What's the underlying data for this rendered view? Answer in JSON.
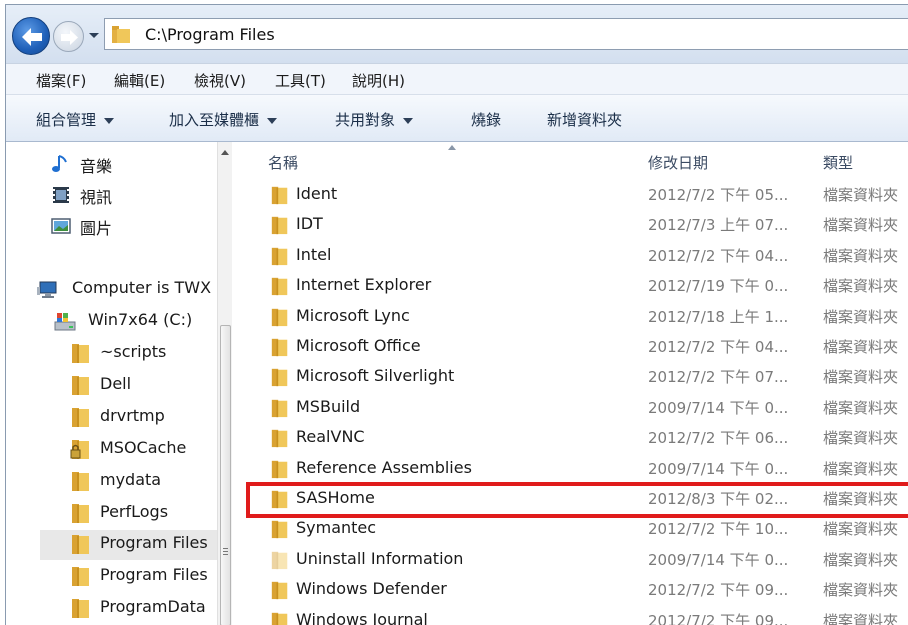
{
  "address": {
    "path": "C:\\Program Files"
  },
  "menu": [
    "檔案(F)",
    "編輯(E)",
    "檢視(V)",
    "工具(T)",
    "說明(H)"
  ],
  "commands": [
    {
      "label": "組合管理",
      "dropdown": true
    },
    {
      "label": "加入至媒體櫃",
      "dropdown": true
    },
    {
      "label": "共用對象",
      "dropdown": true
    },
    {
      "label": "燒錄",
      "dropdown": false
    },
    {
      "label": "新增資料夾",
      "dropdown": false
    }
  ],
  "nav": {
    "libraries": [
      {
        "label": "音樂",
        "icon": "music-icon"
      },
      {
        "label": "視訊",
        "icon": "video-icon"
      },
      {
        "label": "圖片",
        "icon": "picture-icon"
      }
    ],
    "computer": {
      "label": "Computer is TWX",
      "icon": "computer-icon"
    },
    "drive": {
      "label": "Win7x64 (C:)",
      "icon": "drive-icon"
    },
    "folders": [
      {
        "label": "~scripts"
      },
      {
        "label": "Dell"
      },
      {
        "label": "drvrtmp"
      },
      {
        "label": "MSOCache",
        "locked": true
      },
      {
        "label": "mydata"
      },
      {
        "label": "PerfLogs"
      },
      {
        "label": "Program Files",
        "selected": true
      },
      {
        "label": "Program Files"
      },
      {
        "label": "ProgramData"
      }
    ]
  },
  "columns": {
    "name": "名稱",
    "date": "修改日期",
    "type": "類型"
  },
  "files": [
    {
      "name": "Ident",
      "date": "2012/7/2 下午 05...",
      "type": "檔案資料夾"
    },
    {
      "name": "IDT",
      "date": "2012/7/3 上午 07...",
      "type": "檔案資料夾"
    },
    {
      "name": "Intel",
      "date": "2012/7/2 下午 04...",
      "type": "檔案資料夾"
    },
    {
      "name": "Internet Explorer",
      "date": "2012/7/19 下午 0...",
      "type": "檔案資料夾"
    },
    {
      "name": "Microsoft Lync",
      "date": "2012/7/18 上午 1...",
      "type": "檔案資料夾"
    },
    {
      "name": "Microsoft Office",
      "date": "2012/7/2 下午 04...",
      "type": "檔案資料夾"
    },
    {
      "name": "Microsoft Silverlight",
      "date": "2012/7/2 下午 07...",
      "type": "檔案資料夾"
    },
    {
      "name": "MSBuild",
      "date": "2009/7/14 下午 0...",
      "type": "檔案資料夾"
    },
    {
      "name": "RealVNC",
      "date": "2012/7/2 下午 06...",
      "type": "檔案資料夾"
    },
    {
      "name": "Reference Assemblies",
      "date": "2009/7/14 下午 0...",
      "type": "檔案資料夾"
    },
    {
      "name": "SASHome",
      "date": "2012/8/3 下午 02...",
      "type": "檔案資料夾",
      "highlighted": true
    },
    {
      "name": "Symantec",
      "date": "2012/7/2 下午 10...",
      "type": "檔案資料夾"
    },
    {
      "name": "Uninstall Information",
      "date": "2009/7/14 下午 0...",
      "type": "檔案資料夾",
      "faded": true
    },
    {
      "name": "Windows Defender",
      "date": "2012/7/2 下午 09...",
      "type": "檔案資料夾"
    },
    {
      "name": "Windows Journal",
      "date": "2012/7/2 下午 09...",
      "type": "檔案資料夾"
    }
  ],
  "colors": {
    "highlight": "#e01b1b",
    "folder": "#e8b73c",
    "selected_bg": "#e8e8e8"
  }
}
